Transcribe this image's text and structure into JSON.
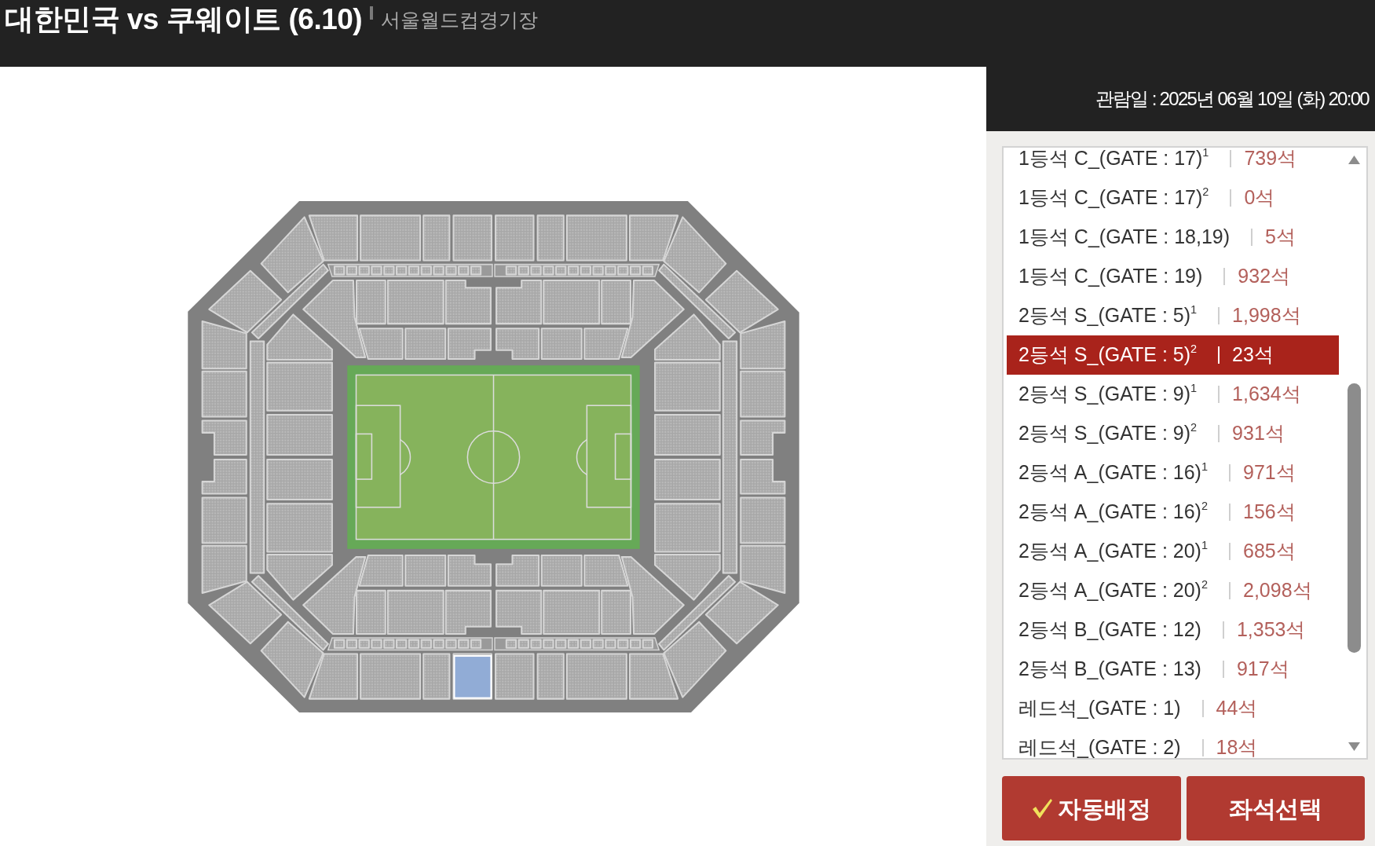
{
  "header": {
    "title": "대한민국 vs 쿠웨이트 (6.10)",
    "venue": "서울월드컵경기장"
  },
  "viewing_date": "관람일 : 2025년 06월 10일 (화) 20:00",
  "seat_grades": [
    {
      "name": "1등석 C_(GATE : 17)$^{1}$",
      "remaining": "739석",
      "selected": false
    },
    {
      "name": "1등석 C_(GATE : 17)$^{2}$",
      "remaining": "0석",
      "selected": false
    },
    {
      "name": "1등석 C_(GATE : 18,19)",
      "remaining": "5석",
      "selected": false
    },
    {
      "name": "1등석 C_(GATE : 19)",
      "remaining": "932석",
      "selected": false
    },
    {
      "name": "2등석 S_(GATE : 5)$^{1}$",
      "remaining": "1,998석",
      "selected": false
    },
    {
      "name": "2등석 S_(GATE : 5)$^{2}$",
      "remaining": "23석",
      "selected": true
    },
    {
      "name": "2등석 S_(GATE : 9)$^{1}$",
      "remaining": "1,634석",
      "selected": false
    },
    {
      "name": "2등석 S_(GATE : 9)$^{2}$",
      "remaining": "931석",
      "selected": false
    },
    {
      "name": "2등석 A_(GATE : 16)$^{1}$",
      "remaining": "971석",
      "selected": false
    },
    {
      "name": "2등석 A_(GATE : 16)$^{2}$",
      "remaining": "156석",
      "selected": false
    },
    {
      "name": "2등석 A_(GATE : 20)$^{1}$",
      "remaining": "685석",
      "selected": false
    },
    {
      "name": "2등석 A_(GATE : 20)$^{2}$",
      "remaining": "2,098석",
      "selected": false
    },
    {
      "name": "2등석 B_(GATE : 12)",
      "remaining": "1,353석",
      "selected": false
    },
    {
      "name": "2등석 B_(GATE : 13)",
      "remaining": "917석",
      "selected": false
    },
    {
      "name": "레드석_(GATE : 1)",
      "remaining": "44석",
      "selected": false
    },
    {
      "name": "레드석_(GATE : 2)",
      "remaining": "18석",
      "selected": false
    }
  ],
  "buttons": [
    {
      "label": "자동배정",
      "kind": "auto"
    },
    {
      "label": "좌석선택",
      "kind": "select"
    }
  ]
}
